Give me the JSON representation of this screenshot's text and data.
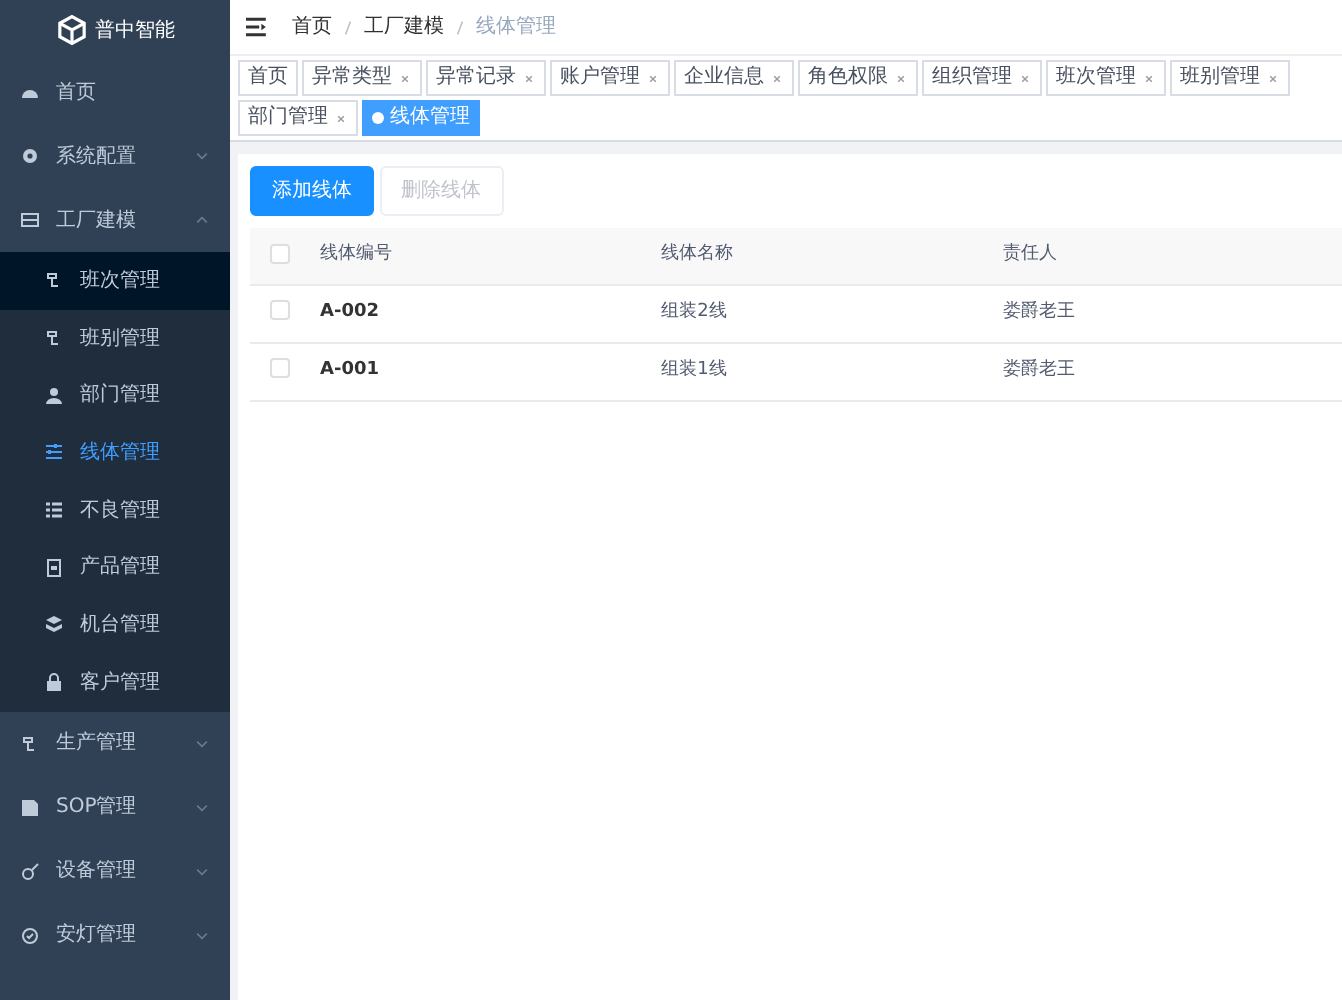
{
  "logo": {
    "text": "普中智能"
  },
  "sidebar": {
    "items": [
      {
        "label": "首页"
      },
      {
        "label": "系统配置",
        "expanded": false
      },
      {
        "label": "工厂建模",
        "expanded": true,
        "children": [
          {
            "label": "班次管理",
            "selected": false,
            "hovered": true
          },
          {
            "label": "班别管理",
            "selected": false,
            "hovered": false
          },
          {
            "label": "部门管理",
            "selected": false,
            "hovered": false
          },
          {
            "label": "线体管理",
            "selected": true,
            "hovered": false
          },
          {
            "label": "不良管理",
            "selected": false,
            "hovered": false
          },
          {
            "label": "产品管理",
            "selected": false,
            "hovered": false
          },
          {
            "label": "机台管理",
            "selected": false,
            "hovered": false
          },
          {
            "label": "客户管理",
            "selected": false,
            "hovered": false
          }
        ]
      },
      {
        "label": "生产管理",
        "expanded": false
      },
      {
        "label": "SOP管理",
        "expanded": false
      },
      {
        "label": "设备管理",
        "expanded": false
      },
      {
        "label": "安灯管理",
        "expanded": false
      }
    ]
  },
  "breadcrumb": [
    "首页",
    "工厂建模",
    "线体管理"
  ],
  "tabs": [
    {
      "label": "首页",
      "selected": false,
      "closable": false
    },
    {
      "label": "异常类型",
      "selected": false,
      "closable": true
    },
    {
      "label": "异常记录",
      "selected": false,
      "closable": true
    },
    {
      "label": "账户管理",
      "selected": false,
      "closable": true
    },
    {
      "label": "企业信息",
      "selected": false,
      "closable": true
    },
    {
      "label": "角色权限",
      "selected": false,
      "closable": true
    },
    {
      "label": "组织管理",
      "selected": false,
      "closable": true
    },
    {
      "label": "班次管理",
      "selected": false,
      "closable": true
    },
    {
      "label": "班别管理",
      "selected": false,
      "closable": true
    },
    {
      "label": "部门管理",
      "selected": false,
      "closable": true
    },
    {
      "label": "线体管理",
      "selected": true,
      "closable": false
    }
  ],
  "toolbar": [
    {
      "label": "添加线体",
      "disabled": false
    },
    {
      "label": "删除线体",
      "disabled": true
    }
  ],
  "table": {
    "header_checked": false,
    "columns": [
      "线体编号",
      "线体名称",
      "责任人"
    ],
    "rows": [
      {
        "checked": false,
        "cells": [
          "A-002",
          "组装2线",
          "娄爵老王"
        ]
      },
      {
        "checked": false,
        "cells": [
          "A-001",
          "组装1线",
          "娄爵老王"
        ]
      }
    ]
  }
}
